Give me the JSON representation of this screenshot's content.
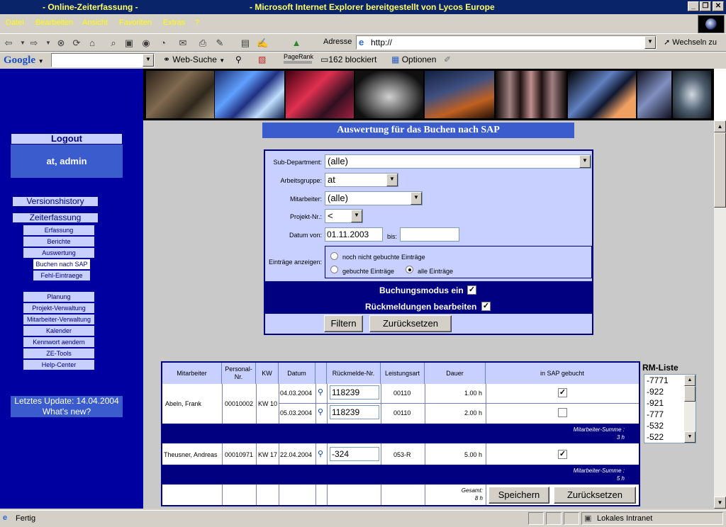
{
  "window": {
    "title_left": "- Online-Zeiterfassung -",
    "title_right": "- Microsoft Internet Explorer bereitgestellt von Lycos Europe",
    "minimize": "_",
    "maximize": "❐",
    "close": "✕"
  },
  "menu": [
    "Datei",
    "Bearbeiten",
    "Ansicht",
    "Favoriten",
    "Extras",
    "?"
  ],
  "addressbar": {
    "label": "Adresse",
    "value": "http://",
    "go_label": "Wechseln zu"
  },
  "googlebar": {
    "logo": "Google",
    "websearch": "Web-Suche",
    "pagerank": "PageRank",
    "blocked": "162 blockiert",
    "options": "Optionen"
  },
  "sidebar": {
    "logout": "Logout",
    "user": "at, admin",
    "versions": "Versionshistory",
    "zeiterfassung": "Zeiterfassung",
    "items": [
      "Erfassung",
      "Berichte",
      "Auswertung",
      "Buchen nach SAP",
      "Fehl-Eintraege"
    ],
    "items2": [
      "Planung",
      "Projekt-Verwaltung",
      "Mitarbeiter-Verwaltung",
      "Kalender",
      "Kennwort aendern",
      "ZE-Tools",
      "Help-Center"
    ],
    "last_update": "Letztes Update: 14.04.2004",
    "whats_new": "What's new?"
  },
  "main": {
    "heading": "Auswertung für das Buchen nach SAP",
    "filter": {
      "subdept_label": "Sub-Department:",
      "subdept_value": "(alle)",
      "group_label": "Arbeitsgruppe:",
      "group_value": "at",
      "employee_label": "Mitarbeiter:",
      "employee_value": "(alle)",
      "project_label": "Projekt-Nr.:",
      "project_value": "<",
      "date_from_label": "Datum von:",
      "date_from_value": "01.11.2003",
      "date_to_label": "bis:",
      "date_to_value": "",
      "show_label": "Einträge anzeigen:",
      "opt_unbooked": "noch nicht gebuchte Einträge",
      "opt_booked": "gebuchte Einträge",
      "opt_all": "alle Einträge",
      "booking_mode": "Buchungsmodus ein",
      "edit_feedback": "Rückmeldungen bearbeiten",
      "filter_btn": "Filtern",
      "reset_btn": "Zurücksetzen"
    },
    "table": {
      "headers": [
        "Mitarbeiter",
        "Personal-Nr.",
        "KW",
        "Datum",
        "",
        "Rückmelde-Nr.",
        "Leistungsart",
        "Dauer",
        "in SAP gebucht"
      ],
      "groups": [
        {
          "name": "Abeln, Frank",
          "personal": "00010002",
          "kw": "KW 10",
          "rows": [
            {
              "date": "04.03.2004",
              "rm": "118239",
              "art": "00110",
              "dauer": "1.00 h",
              "booked": true
            },
            {
              "date": "05.03.2004",
              "rm": "118239",
              "art": "00110",
              "dauer": "2.00 h",
              "booked": false
            }
          ],
          "sum_label": "Mitarbeiter-Summe :",
          "sum_value": "3 h"
        },
        {
          "name": "Theusner, Andreas",
          "personal": "00010971",
          "kw": "KW 17",
          "rows": [
            {
              "date": "22.04.2004",
              "rm": "-324",
              "art": "053-R",
              "dauer": "5.00 h",
              "booked": true
            }
          ],
          "sum_label": "Mitarbeiter-Summe :",
          "sum_value": "5 h"
        }
      ],
      "total_label": "Gesamt:",
      "total_value": "8 h",
      "save_btn": "Speichern",
      "reset_btn": "Zurücksetzen"
    },
    "rm_list": {
      "title": "RM-Liste",
      "items": [
        "-7771",
        "-922",
        "-921",
        "-777",
        "-532",
        "-522"
      ]
    }
  },
  "status": {
    "text": "Fertig",
    "zone": "Lokales Intranet"
  }
}
